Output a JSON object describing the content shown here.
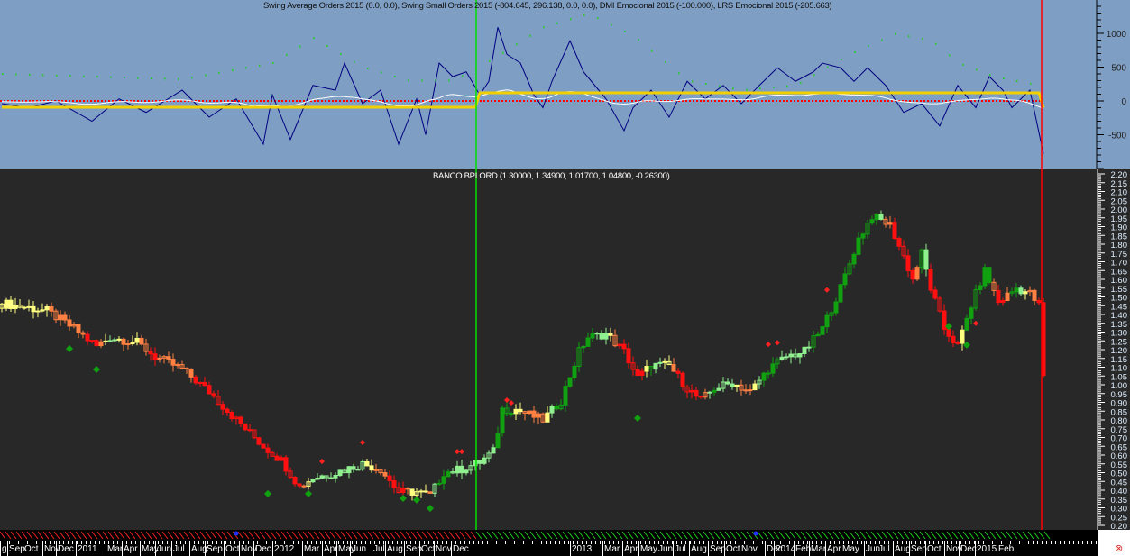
{
  "colors": {
    "top_bg": "#7f9ec3",
    "bottom_bg": "#282828",
    "osc_line": "#000080",
    "slow_line": "#22cc22",
    "white_line": "#ffffff",
    "step_line": "#f0d000",
    "zero_line": "#ff0000",
    "cursor_green": "#00e000",
    "cursor_red": "#ff0000"
  },
  "close_icon": "circle-x-icon",
  "chart_data": [
    {
      "type": "line",
      "title": "Swing Average Orders 2015 (0.0, 0.0), Swing Small Orders 2015 (-804.645, 296.138, 0.0, 0.0), DMI Emocional 2015 (-100.000), LRS Emocional 2015 (-205.663)",
      "ylim": [
        -1000,
        1500
      ],
      "yticks": [
        1000,
        500,
        0,
        -500
      ],
      "ytick_labels": [
        "1000",
        "500",
        "0",
        "-500"
      ],
      "x_unit": "bar index (weekly)",
      "series": [
        {
          "name": "Swing Small Orders",
          "points": [
            [
              0,
              -40
            ],
            [
              6,
              -100
            ],
            [
              12,
              0
            ],
            [
              20,
              -300
            ],
            [
              26,
              30
            ],
            [
              32,
              -170
            ],
            [
              40,
              160
            ],
            [
              46,
              -240
            ],
            [
              52,
              30
            ],
            [
              58,
              -640
            ],
            [
              60,
              90
            ],
            [
              64,
              -570
            ],
            [
              69,
              230
            ],
            [
              74,
              160
            ],
            [
              76,
              560
            ],
            [
              80,
              -40
            ],
            [
              84,
              160
            ],
            [
              88,
              -640
            ],
            [
              92,
              30
            ],
            [
              94,
              -500
            ],
            [
              97,
              560
            ],
            [
              100,
              360
            ],
            [
              103,
              430
            ],
            [
              106,
              90
            ],
            [
              108,
              290
            ],
            [
              110,
              1090
            ],
            [
              112,
              690
            ],
            [
              115,
              560
            ],
            [
              118,
              90
            ],
            [
              120,
              -100
            ],
            [
              122,
              290
            ],
            [
              126,
              890
            ],
            [
              129,
              430
            ],
            [
              134,
              30
            ],
            [
              138,
              -440
            ],
            [
              140,
              -100
            ],
            [
              144,
              160
            ],
            [
              148,
              -240
            ],
            [
              152,
              290
            ],
            [
              156,
              30
            ],
            [
              160,
              230
            ],
            [
              164,
              -40
            ],
            [
              168,
              230
            ],
            [
              172,
              490
            ],
            [
              176,
              290
            ],
            [
              180,
              430
            ],
            [
              182,
              560
            ],
            [
              186,
              490
            ],
            [
              189,
              290
            ],
            [
              192,
              490
            ],
            [
              196,
              230
            ],
            [
              200,
              -170
            ],
            [
              204,
              -40
            ],
            [
              208,
              -370
            ],
            [
              212,
              230
            ],
            [
              216,
              -100
            ],
            [
              219,
              360
            ],
            [
              222,
              160
            ],
            [
              224,
              -100
            ],
            [
              228,
              160
            ],
            [
              231,
              -780
            ]
          ]
        },
        {
          "name": "Slow oscillator (dotted)",
          "points": [
            [
              0,
              400
            ],
            [
              20,
              360
            ],
            [
              40,
              320
            ],
            [
              60,
              560
            ],
            [
              69,
              930
            ],
            [
              80,
              500
            ],
            [
              90,
              300
            ],
            [
              100,
              300
            ],
            [
              106,
              500
            ],
            [
              120,
              1090
            ],
            [
              130,
              1290
            ],
            [
              140,
              960
            ],
            [
              152,
              300
            ],
            [
              164,
              160
            ],
            [
              176,
              230
            ],
            [
              188,
              690
            ],
            [
              198,
              990
            ],
            [
              206,
              900
            ],
            [
              212,
              560
            ],
            [
              220,
              360
            ],
            [
              230,
              230
            ]
          ]
        },
        {
          "name": "DMI Emocional (step)",
          "points": [
            [
              0,
              -93
            ],
            [
              105,
              -93
            ],
            [
              106,
              120
            ],
            [
              230,
              120
            ],
            [
              231,
              -100
            ]
          ]
        },
        {
          "name": "Zero line",
          "points": [
            [
              0,
              0
            ],
            [
              231,
              0
            ]
          ]
        }
      ]
    },
    {
      "type": "candlestick",
      "title": "BANCO BPI ORD (1.30000, 1.34900, 1.01700, 1.04800, -0.26300)",
      "ylim": [
        0.2,
        2.2
      ],
      "ytick_labels": [
        "2.20",
        "2.15",
        "2.10",
        "2.05",
        "2.00",
        "1.95",
        "1.90",
        "1.85",
        "1.80",
        "1.75",
        "1.70",
        "1.65",
        "1.60",
        "1.55",
        "1.50",
        "1.45",
        "1.40",
        "1.35",
        "1.30",
        "1.25",
        "1.20",
        "1.15",
        "1.10",
        "1.05",
        "1.00",
        "0.95",
        "0.90",
        "0.85",
        "0.80",
        "0.75",
        "0.70",
        "0.65",
        "0.60",
        "0.55",
        "0.50",
        "0.45",
        "0.40",
        "0.35",
        "0.30",
        "0.25",
        "0.20"
      ],
      "close_anchors": [
        [
          1,
          1.46
        ],
        [
          10,
          1.42
        ],
        [
          16,
          1.32
        ],
        [
          21,
          1.22
        ],
        [
          24,
          1.27
        ],
        [
          30,
          1.24
        ],
        [
          34,
          1.16
        ],
        [
          40,
          1.09
        ],
        [
          46,
          0.96
        ],
        [
          52,
          0.8
        ],
        [
          58,
          0.65
        ],
        [
          62,
          0.57
        ],
        [
          66,
          0.42
        ],
        [
          69,
          0.47
        ],
        [
          74,
          0.5
        ],
        [
          80,
          0.55
        ],
        [
          84,
          0.52
        ],
        [
          88,
          0.39
        ],
        [
          92,
          0.39
        ],
        [
          95,
          0.37
        ],
        [
          98,
          0.5
        ],
        [
          102,
          0.52
        ],
        [
          106,
          0.56
        ],
        [
          109,
          0.62
        ],
        [
          111,
          0.86
        ],
        [
          114,
          0.86
        ],
        [
          120,
          0.8
        ],
        [
          124,
          0.91
        ],
        [
          128,
          1.19
        ],
        [
          130,
          1.27
        ],
        [
          134,
          1.29
        ],
        [
          138,
          1.19
        ],
        [
          141,
          1.04
        ],
        [
          144,
          1.11
        ],
        [
          148,
          1.11
        ],
        [
          152,
          0.98
        ],
        [
          155,
          0.91
        ],
        [
          158,
          0.98
        ],
        [
          162,
          1.01
        ],
        [
          166,
          0.96
        ],
        [
          170,
          1.09
        ],
        [
          174,
          1.16
        ],
        [
          178,
          1.19
        ],
        [
          182,
          1.32
        ],
        [
          186,
          1.55
        ],
        [
          190,
          1.83
        ],
        [
          193,
          1.96
        ],
        [
          197,
          1.91
        ],
        [
          200,
          1.73
        ],
        [
          202,
          1.6
        ],
        [
          204,
          1.75
        ],
        [
          206,
          1.55
        ],
        [
          209,
          1.32
        ],
        [
          212,
          1.22
        ],
        [
          215,
          1.45
        ],
        [
          218,
          1.65
        ],
        [
          221,
          1.47
        ],
        [
          225,
          1.55
        ],
        [
          228,
          1.52
        ],
        [
          230,
          1.45
        ],
        [
          231,
          1.05
        ]
      ],
      "buy_signals": [
        [
          15,
          1.205
        ],
        [
          21,
          1.087
        ],
        [
          59,
          0.38
        ],
        [
          68,
          0.38
        ],
        [
          89,
          0.354
        ],
        [
          92,
          0.344
        ],
        [
          95,
          0.297
        ],
        [
          141,
          0.81
        ],
        [
          210,
          1.333
        ],
        [
          214,
          1.226
        ]
      ],
      "sell_signals": [
        [
          71,
          0.564
        ],
        [
          80,
          0.672
        ],
        [
          101,
          0.62
        ],
        [
          102,
          0.62
        ],
        [
          112,
          0.913
        ],
        [
          113,
          0.897
        ],
        [
          170,
          1.23
        ],
        [
          172,
          1.24
        ],
        [
          183,
          1.54
        ],
        [
          216,
          1.35
        ]
      ]
    }
  ],
  "date_axis": {
    "labels": [
      "g",
      "Sep",
      "Oct",
      "Nov",
      "Dec",
      "2011",
      "Mar",
      "Apr",
      "May",
      "Jun",
      "Jul",
      "Aug",
      "Sep",
      "Oct",
      "Nov",
      "Dec",
      "2012",
      "Mar",
      "Apr",
      "May",
      "Jun",
      "Jul",
      "Aug",
      "Sep",
      "Oct",
      "Nov",
      "Dec",
      "2013",
      "Mar",
      "Apr",
      "May",
      "Jun",
      "Jul",
      "Aug",
      "Sep",
      "Oct",
      "Nov",
      "Dec",
      "2014",
      "Feb",
      "Mar",
      "Apr",
      "May",
      "Jun",
      "Jul",
      "Aug",
      "Sep",
      "Oct",
      "Nov",
      "Dec",
      "2015",
      "Feb"
    ]
  }
}
